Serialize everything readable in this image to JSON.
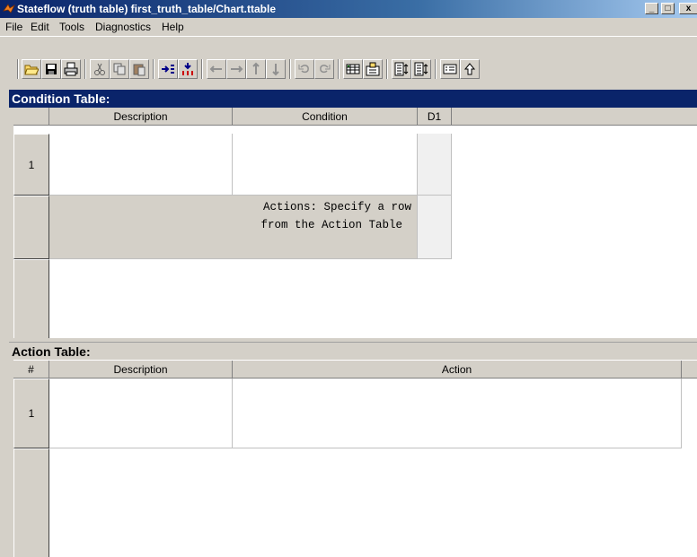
{
  "window": {
    "title": "Stateflow (truth table) first_truth_table/Chart.ttable",
    "controls": {
      "minimize": "_",
      "maximize": "□",
      "close": "x"
    }
  },
  "menu": {
    "items": [
      "File",
      "Edit",
      "Tools",
      "Diagnostics",
      "Help"
    ]
  },
  "toolbar": {
    "icons": [
      "open-icon",
      "save-icon",
      "print-icon",
      "cut-icon",
      "copy-icon",
      "paste-icon",
      "insert-row-icon",
      "insert-column-icon",
      "move-left-icon",
      "move-right-icon",
      "move-up-icon",
      "move-down-icon",
      "undo-icon",
      "redo-icon",
      "edit-data-icon",
      "model-explorer-icon",
      "align-left-icon",
      "align-right-icon",
      "properties-icon",
      "up-icon"
    ]
  },
  "condition_table": {
    "title": "Condition Table:",
    "columns": [
      "",
      "Description",
      "Condition",
      "D1"
    ],
    "rows": [
      {
        "label": "1",
        "description": "",
        "condition": "",
        "d1": ""
      }
    ],
    "actions_row": {
      "label": "",
      "text_line1": "Actions: Specify a row",
      "text_line2": "from the Action Table"
    }
  },
  "action_table": {
    "title": "Action Table:",
    "columns": [
      "#",
      "Description",
      "Action"
    ],
    "rows": [
      {
        "label": "1",
        "description": "",
        "action": ""
      }
    ]
  },
  "colors": {
    "titlebar": "#0a246a",
    "face": "#d4d0c8",
    "active_header": "#0a246a"
  }
}
